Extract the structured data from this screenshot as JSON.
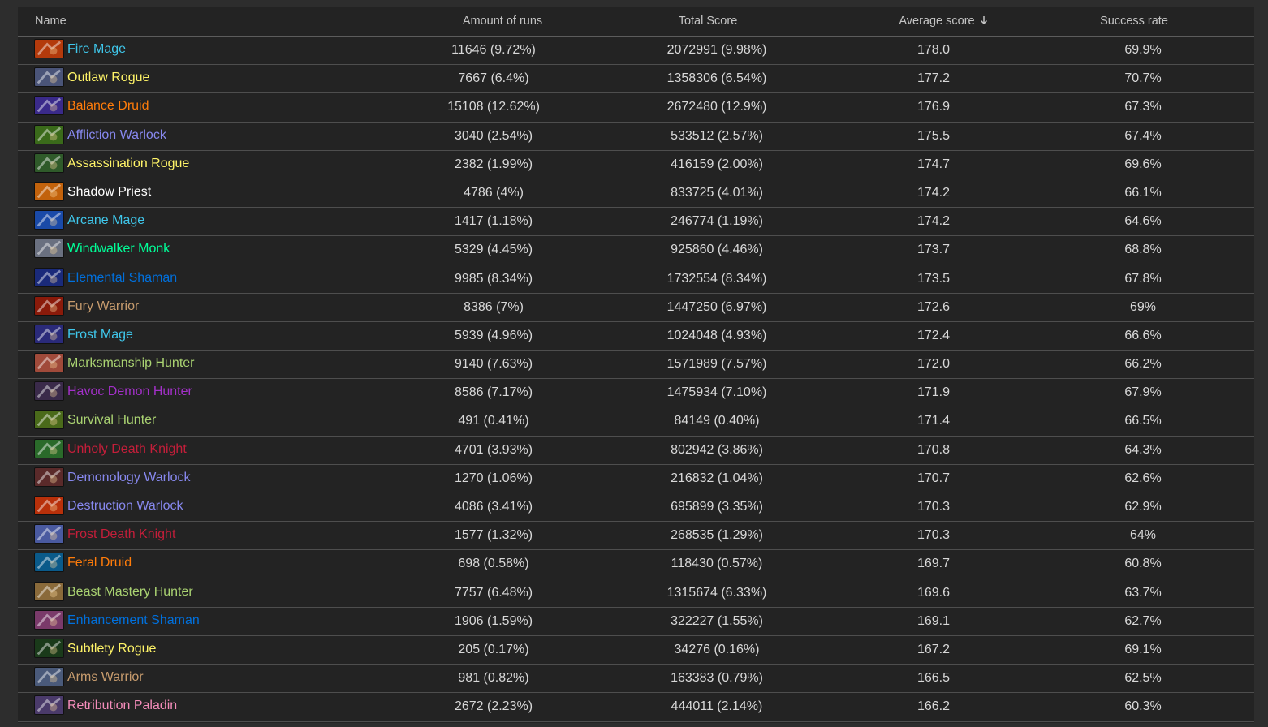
{
  "headers": {
    "name": "Name",
    "runs": "Amount of runs",
    "total": "Total Score",
    "avg": "Average score",
    "success": "Success rate"
  },
  "rows": [
    {
      "name": "Fire Mage",
      "icon": "fire-mage-icon",
      "color": "#3fc7eb",
      "icon_bg": "#b33a0c",
      "runs": "11646 (9.72%)",
      "total": "2072991 (9.98%)",
      "avg": "178.0",
      "success": "69.9%"
    },
    {
      "name": "Outlaw Rogue",
      "icon": "outlaw-rogue-icon",
      "color": "#fff468",
      "icon_bg": "#4a5478",
      "runs": "7667 (6.4%)",
      "total": "1358306 (6.54%)",
      "avg": "177.2",
      "success": "70.7%"
    },
    {
      "name": "Balance Druid",
      "icon": "balance-druid-icon",
      "color": "#ff7c0a",
      "icon_bg": "#3a2a8a",
      "runs": "15108 (12.62%)",
      "total": "2672480 (12.9%)",
      "avg": "176.9",
      "success": "67.3%"
    },
    {
      "name": "Affliction Warlock",
      "icon": "affliction-warlock-icon",
      "color": "#8788ee",
      "icon_bg": "#3a6a1a",
      "runs": "3040 (2.54%)",
      "total": "533512 (2.57%)",
      "avg": "175.5",
      "success": "67.4%"
    },
    {
      "name": "Assassination Rogue",
      "icon": "assassination-rogue-icon",
      "color": "#fff468",
      "icon_bg": "#2f5a2a",
      "runs": "2382 (1.99%)",
      "total": "416159 (2.00%)",
      "avg": "174.7",
      "success": "69.6%"
    },
    {
      "name": "Shadow Priest",
      "icon": "shadow-priest-icon",
      "color": "#ffffff",
      "icon_bg": "#c2620c",
      "runs": "4786 (4%)",
      "total": "833725 (4.01%)",
      "avg": "174.2",
      "success": "66.1%"
    },
    {
      "name": "Arcane Mage",
      "icon": "arcane-mage-icon",
      "color": "#3fc7eb",
      "icon_bg": "#1a4aa8",
      "runs": "1417 (1.18%)",
      "total": "246774 (1.19%)",
      "avg": "174.2",
      "success": "64.6%"
    },
    {
      "name": "Windwalker Monk",
      "icon": "windwalker-monk-icon",
      "color": "#00ff98",
      "icon_bg": "#6a7080",
      "runs": "5329 (4.45%)",
      "total": "925860 (4.46%)",
      "avg": "173.7",
      "success": "68.8%"
    },
    {
      "name": "Elemental Shaman",
      "icon": "elemental-shaman-icon",
      "color": "#0070dd",
      "icon_bg": "#1a2a7a",
      "runs": "9985 (8.34%)",
      "total": "1732554 (8.34%)",
      "avg": "173.5",
      "success": "67.8%"
    },
    {
      "name": "Fury Warrior",
      "icon": "fury-warrior-icon",
      "color": "#c69b6d",
      "icon_bg": "#8a1a0a",
      "runs": "8386 (7%)",
      "total": "1447250 (6.97%)",
      "avg": "172.6",
      "success": "69%"
    },
    {
      "name": "Frost Mage",
      "icon": "frost-mage-icon",
      "color": "#3fc7eb",
      "icon_bg": "#2a2a7a",
      "runs": "5939 (4.96%)",
      "total": "1024048 (4.93%)",
      "avg": "172.4",
      "success": "66.6%"
    },
    {
      "name": "Marksmanship Hunter",
      "icon": "marksmanship-hunter-icon",
      "color": "#aad372",
      "icon_bg": "#a04a3a",
      "runs": "9140 (7.63%)",
      "total": "1571989 (7.57%)",
      "avg": "172.0",
      "success": "66.2%"
    },
    {
      "name": "Havoc Demon Hunter",
      "icon": "havoc-demon-hunter-icon",
      "color": "#a330c9",
      "icon_bg": "#3a2a4a",
      "runs": "8586 (7.17%)",
      "total": "1475934 (7.10%)",
      "avg": "171.9",
      "success": "67.9%"
    },
    {
      "name": "Survival Hunter",
      "icon": "survival-hunter-icon",
      "color": "#aad372",
      "icon_bg": "#4a6a1a",
      "runs": "491 (0.41%)",
      "total": "84149 (0.40%)",
      "avg": "171.4",
      "success": "66.5%"
    },
    {
      "name": "Unholy Death Knight",
      "icon": "unholy-death-knight-icon",
      "color": "#c41e3a",
      "icon_bg": "#2a6a2a",
      "runs": "4701 (3.93%)",
      "total": "802942 (3.86%)",
      "avg": "170.8",
      "success": "64.3%"
    },
    {
      "name": "Demonology Warlock",
      "icon": "demonology-warlock-icon",
      "color": "#8788ee",
      "icon_bg": "#5a2a2a",
      "runs": "1270 (1.06%)",
      "total": "216832 (1.04%)",
      "avg": "170.7",
      "success": "62.6%"
    },
    {
      "name": "Destruction Warlock",
      "icon": "destruction-warlock-icon",
      "color": "#8788ee",
      "icon_bg": "#b8300a",
      "runs": "4086 (3.41%)",
      "total": "695899 (3.35%)",
      "avg": "170.3",
      "success": "62.9%"
    },
    {
      "name": "Frost Death Knight",
      "icon": "frost-death-knight-icon",
      "color": "#c41e3a",
      "icon_bg": "#4a5aa0",
      "runs": "1577 (1.32%)",
      "total": "268535 (1.29%)",
      "avg": "170.3",
      "success": "64%"
    },
    {
      "name": "Feral Druid",
      "icon": "feral-druid-icon",
      "color": "#ff7c0a",
      "icon_bg": "#0a5a8a",
      "runs": "698 (0.58%)",
      "total": "118430 (0.57%)",
      "avg": "169.7",
      "success": "60.8%"
    },
    {
      "name": "Beast Mastery Hunter",
      "icon": "beast-mastery-hunter-icon",
      "color": "#aad372",
      "icon_bg": "#8a6a3a",
      "runs": "7757 (6.48%)",
      "total": "1315674 (6.33%)",
      "avg": "169.6",
      "success": "63.7%"
    },
    {
      "name": "Enhancement Shaman",
      "icon": "enhancement-shaman-icon",
      "color": "#0070dd",
      "icon_bg": "#7a3a6a",
      "runs": "1906 (1.59%)",
      "total": "322227 (1.55%)",
      "avg": "169.1",
      "success": "62.7%"
    },
    {
      "name": "Subtlety Rogue",
      "icon": "subtlety-rogue-icon",
      "color": "#fff468",
      "icon_bg": "#1a3a1a",
      "runs": "205 (0.17%)",
      "total": "34276 (0.16%)",
      "avg": "167.2",
      "success": "69.1%"
    },
    {
      "name": "Arms Warrior",
      "icon": "arms-warrior-icon",
      "color": "#c69b6d",
      "icon_bg": "#4a5a7a",
      "runs": "981 (0.82%)",
      "total": "163383 (0.79%)",
      "avg": "166.5",
      "success": "62.5%"
    },
    {
      "name": "Retribution Paladin",
      "icon": "retribution-paladin-icon",
      "color": "#f48cba",
      "icon_bg": "#4a3a6a",
      "runs": "2672 (2.23%)",
      "total": "444011 (2.14%)",
      "avg": "166.2",
      "success": "60.3%"
    }
  ]
}
